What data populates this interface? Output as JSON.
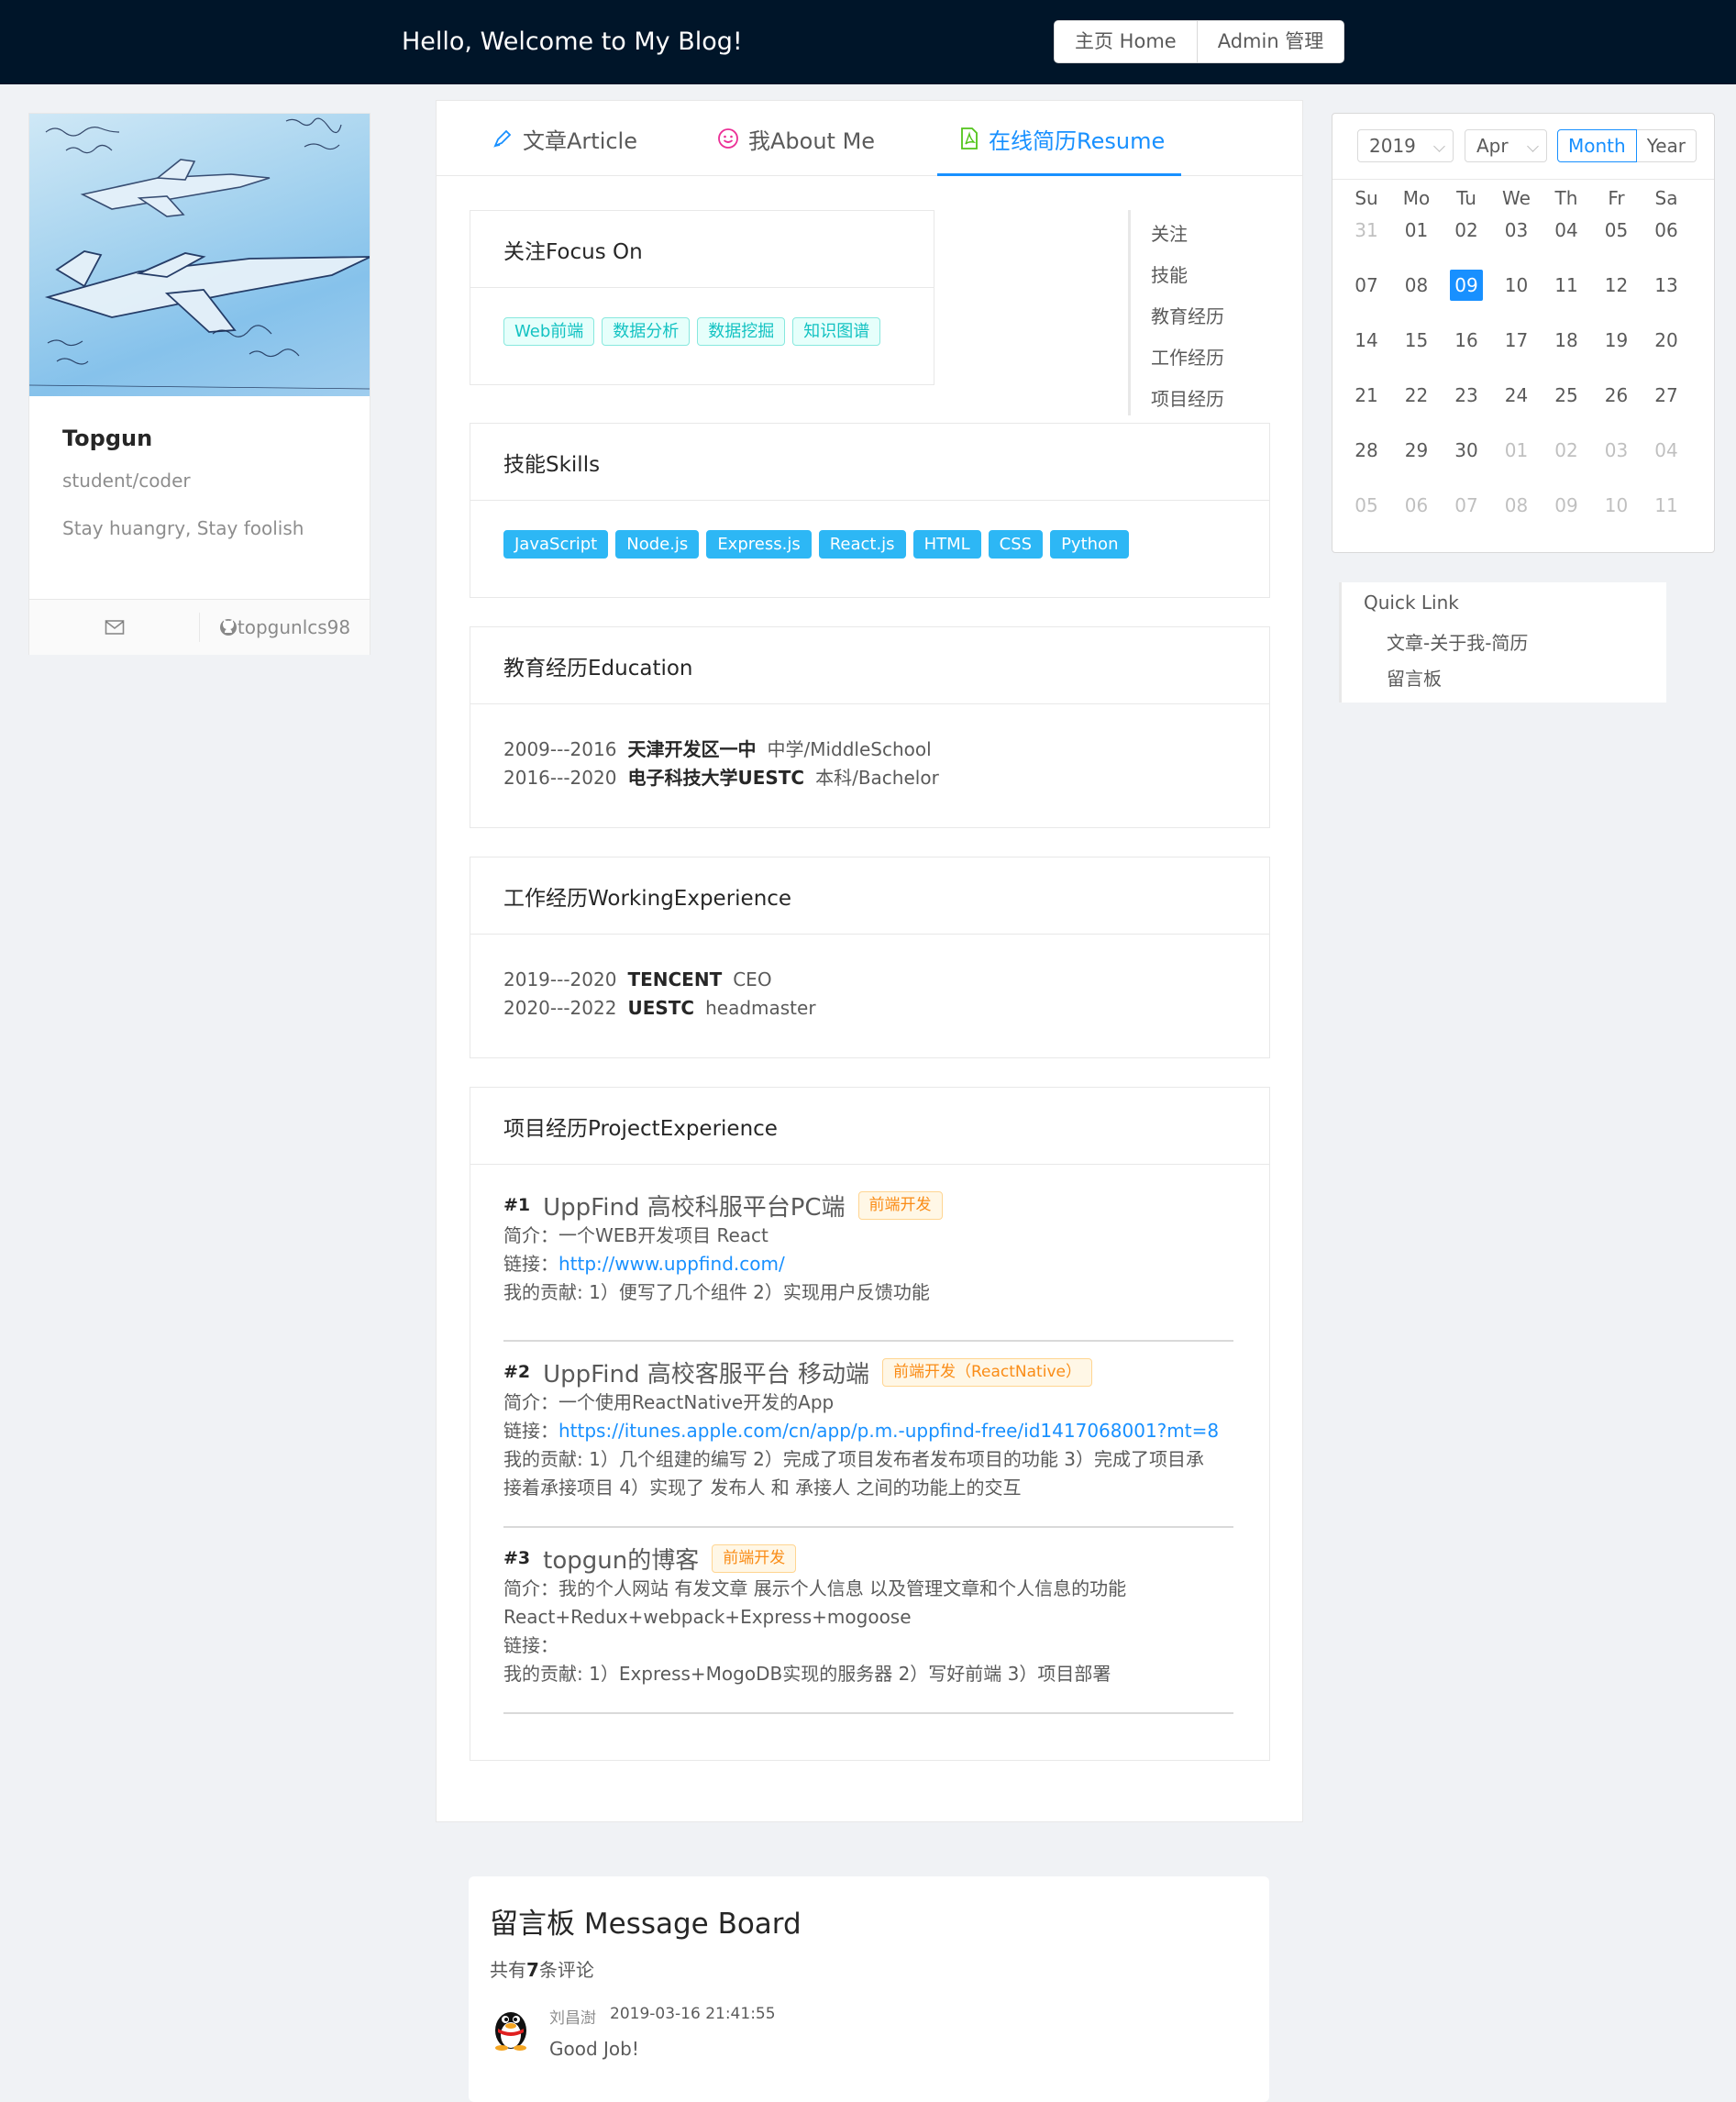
{
  "header": {
    "title": "Hello, Welcome to My Blog!",
    "nav": [
      "主页 Home",
      "Admin 管理"
    ]
  },
  "profile": {
    "name": "Topgun",
    "role": "student/coder",
    "motto": "Stay huangry, Stay foolish",
    "mail_icon": "mail-icon",
    "github_icon": "github-icon",
    "github": "topgunlcs98"
  },
  "tabs": [
    {
      "label": "文章Article",
      "icon": "edit-icon"
    },
    {
      "label": "我About Me",
      "icon": "smile-icon"
    },
    {
      "label": "在线简历Resume",
      "icon": "file-pdf-icon",
      "active": true
    }
  ],
  "anchor_links": [
    "关注",
    "技能",
    "教育经历",
    "工作经历",
    "项目经历"
  ],
  "focus": {
    "title": "关注Focus On",
    "tags": [
      "Web前端",
      "数据分析",
      "数据挖掘",
      "知识图谱"
    ]
  },
  "skills": {
    "title": "技能Skills",
    "tags": [
      "JavaScript",
      "Node.js",
      "Express.js",
      "React.js",
      "HTML",
      "CSS",
      "Python"
    ]
  },
  "education": {
    "title": "教育经历Education",
    "rows": [
      {
        "period": "2009---2016",
        "school": "天津开发区一中",
        "level": "中学/MiddleSchool"
      },
      {
        "period": "2016---2020",
        "school": "电子科技大学UESTC",
        "level": "本科/Bachelor"
      }
    ]
  },
  "work": {
    "title": "工作经历WorkingExperience",
    "rows": [
      {
        "period": "2019---2020",
        "company": "TENCENT",
        "position": "CEO"
      },
      {
        "period": "2020---2022",
        "company": "UESTC",
        "position": "headmaster"
      }
    ]
  },
  "projects": {
    "title": "项目经历ProjectExperience",
    "items": [
      {
        "num": "#1",
        "name": "UppFind 高校科服平台PC端",
        "tag": "前端开发",
        "intro": "简介：一个WEB开发项目 React",
        "link_label": "链接：",
        "link": "http://www.uppfind.com/",
        "contrib": "我的贡献: 1）便写了几个组件 2）实现用户反馈功能"
      },
      {
        "num": "#2",
        "name": "UppFind 高校客服平台 移动端",
        "tag": "前端开发（ReactNative）",
        "intro": "简介：一个使用ReactNative开发的App",
        "link_label": "链接：",
        "link": "https://itunes.apple.com/cn/app/p.m.-uppfind-free/id1417068001?mt=8",
        "contrib": "我的贡献: 1）几个组建的编写 2）完成了项目发布者发布项目的功能 3）完成了项目承",
        "contrib2": "接着承接项目 4）实现了 发布人 和 承接人 之间的功能上的交互"
      },
      {
        "num": "#3",
        "name": "topgun的博客",
        "tag": "前端开发",
        "intro": "简介：我的个人网站 有发文章 展示个人信息 以及管理文章和个人信息的功能",
        "stack": "React+Redux+webpack+Express+mogoose",
        "link_label": "链接：",
        "contrib": "我的贡献: 1）Express+MogoDB实现的服务器 2）写好前端 3）项目部署"
      }
    ]
  },
  "calendar": {
    "year": "2019",
    "month": "Apr",
    "modes": [
      "Month",
      "Year"
    ],
    "active_mode": "Month",
    "weekdays": [
      "Su",
      "Mo",
      "Tu",
      "We",
      "Th",
      "Fr",
      "Sa"
    ],
    "weeks": [
      [
        "31",
        "01",
        "02",
        "03",
        "04",
        "05",
        "06"
      ],
      [
        "07",
        "08",
        "09",
        "10",
        "11",
        "12",
        "13"
      ],
      [
        "14",
        "15",
        "16",
        "17",
        "18",
        "19",
        "20"
      ],
      [
        "21",
        "22",
        "23",
        "24",
        "25",
        "26",
        "27"
      ],
      [
        "28",
        "29",
        "30",
        "01",
        "02",
        "03",
        "04"
      ],
      [
        "05",
        "06",
        "07",
        "08",
        "09",
        "10",
        "11"
      ]
    ],
    "selected": "09"
  },
  "quick_link": {
    "title": "Quick Link",
    "links": [
      "文章-关于我-简历",
      "留言板"
    ]
  },
  "message_board": {
    "title": "留言板 Message Board",
    "count_prefix": "共有",
    "count": "7",
    "count_suffix": "条评论",
    "comments": [
      {
        "author": "刘昌澍",
        "time": "2019-03-16 21:41:55",
        "content": "Good Job!",
        "avatar": "qq-penguin-avatar"
      }
    ]
  },
  "colors": {
    "header_bg": "#001529",
    "primary": "#1890ff",
    "cyan_tag": "#13c2c2",
    "skill_tag": "#2db7f5",
    "orange_tag": "#fa8c16",
    "page_bg": "#f0f2f5"
  }
}
